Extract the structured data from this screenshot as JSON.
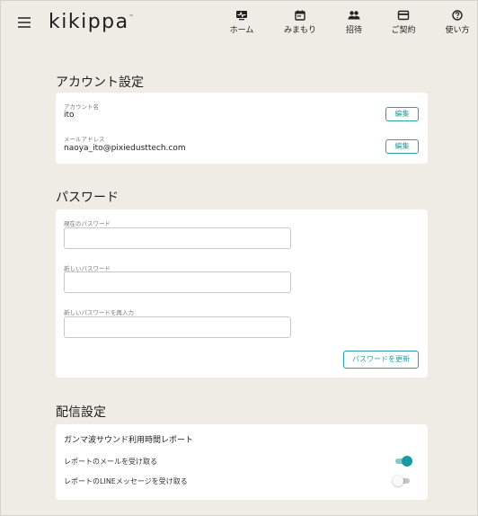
{
  "header": {
    "logo": "kikippa",
    "logo_mark": "™",
    "nav": [
      {
        "label": "ホーム",
        "icon": "home-monitor-icon"
      },
      {
        "label": "みまもり",
        "icon": "calendar-icon"
      },
      {
        "label": "招待",
        "icon": "people-icon"
      },
      {
        "label": "ご契約",
        "icon": "credit-card-icon"
      },
      {
        "label": "使い方",
        "icon": "help-circle-icon"
      }
    ]
  },
  "account": {
    "title": "アカウント設定",
    "name_label": "アカウント名",
    "name_value": "ito",
    "email_label": "メールアドレス",
    "email_value": "naoya_ito@pixiedusttech.com",
    "edit_label": "編集"
  },
  "password": {
    "title": "パスワード",
    "current_label": "現在のパスワード",
    "new_label": "新しいパスワード",
    "confirm_label": "新しいパスワードを再入力",
    "current_value": "",
    "new_value": "",
    "confirm_value": "",
    "update_label": "パスワードを更新"
  },
  "distribution": {
    "title": "配信設定",
    "subtitle": "ガンマ波サウンド利用時間レポート",
    "rows": [
      {
        "label": "レポートのメールを受け取る",
        "enabled": true
      },
      {
        "label": "レポートのLINEメッセージを受け取る",
        "enabled": false
      }
    ]
  },
  "colors": {
    "accent": "#1c9aa3",
    "background": "#efece6",
    "card": "#ffffff"
  }
}
